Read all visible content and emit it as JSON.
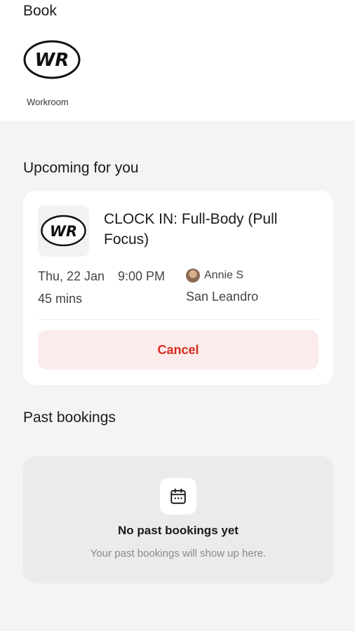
{
  "header": {
    "title": "Book",
    "studio": {
      "name": "Workroom",
      "logo_text": "WR"
    }
  },
  "upcoming": {
    "section_title": "Upcoming for you",
    "booking": {
      "class_title": "CLOCK IN: Full-Body (Pull Focus)",
      "thumbnail_text": "WR",
      "date": "Thu, 22 Jan",
      "time": "9:00 PM",
      "duration": "45 mins",
      "instructor": "Annie S",
      "location": "San Leandro",
      "cancel_label": "Cancel"
    }
  },
  "past": {
    "section_title": "Past bookings",
    "empty_icon": "calendar-icon",
    "empty_title": "No past bookings yet",
    "empty_subtitle": "Your past bookings will show up here."
  },
  "colors": {
    "danger": "#d92d20",
    "danger_bg": "#fbeceb",
    "page_bg": "#f4f4f5",
    "card_bg": "#ffffff"
  }
}
